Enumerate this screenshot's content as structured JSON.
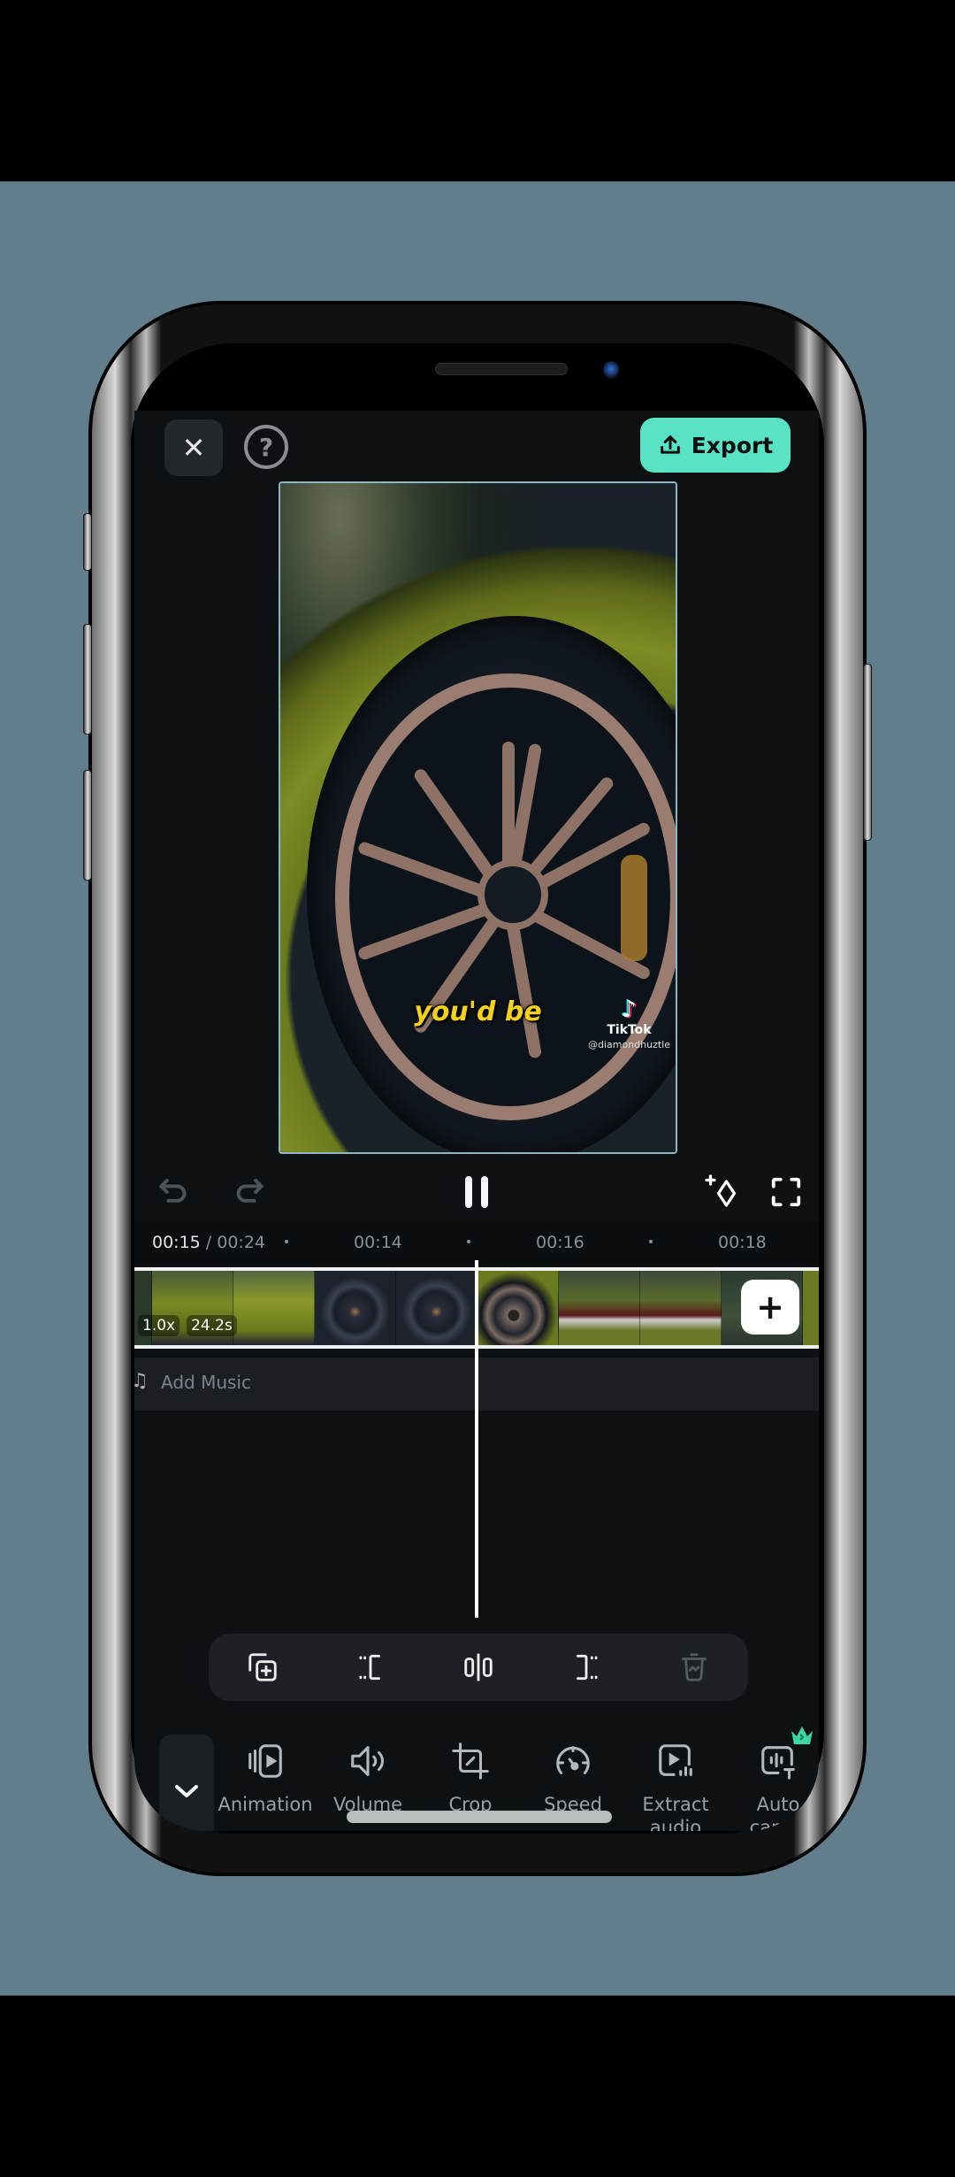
{
  "topbar": {
    "close_icon": "close-icon",
    "help_icon": "help-icon",
    "export_label": "Export",
    "export_icon": "upload-icon",
    "accent_color": "#59e3c4"
  },
  "preview": {
    "caption": "you'd be",
    "watermark_brand": "TikTok",
    "watermark_handle": "@diamondhuztle"
  },
  "playback": {
    "undo_icon": "undo-icon",
    "redo_icon": "redo-icon",
    "pause_icon": "pause-icon",
    "keyframe_icon": "add-keyframe-icon",
    "fullscreen_icon": "fullscreen-icon"
  },
  "timeline": {
    "current_time": "00:15",
    "separator": " / ",
    "total_time": "00:24",
    "ticks": [
      "00:14",
      "00:16",
      "00:18"
    ],
    "clip_speed": "1.0x",
    "clip_duration": "24.2s",
    "add_clip_label": "+",
    "add_music_label": "Add Music"
  },
  "edit_toolbar": {
    "items": [
      {
        "name": "duplicate",
        "icon": "duplicate-icon"
      },
      {
        "name": "trim-start",
        "icon": "trim-left-icon"
      },
      {
        "name": "split",
        "icon": "split-icon"
      },
      {
        "name": "trim-end",
        "icon": "trim-right-icon"
      },
      {
        "name": "delete",
        "icon": "delete-icon",
        "disabled": true
      }
    ]
  },
  "bottom_tools": {
    "collapse_icon": "chevron-down-icon",
    "items": [
      {
        "label": "Animation",
        "icon": "animation-icon"
      },
      {
        "label": "Volume",
        "icon": "volume-icon"
      },
      {
        "label": "Crop",
        "icon": "crop-icon"
      },
      {
        "label": "Speed",
        "icon": "speed-icon"
      },
      {
        "label": "Extract audio",
        "icon": "extract-audio-icon"
      },
      {
        "label": "Auto captio",
        "icon": "auto-captions-icon",
        "premium": true
      }
    ],
    "premium_color": "#3fd6a6"
  }
}
